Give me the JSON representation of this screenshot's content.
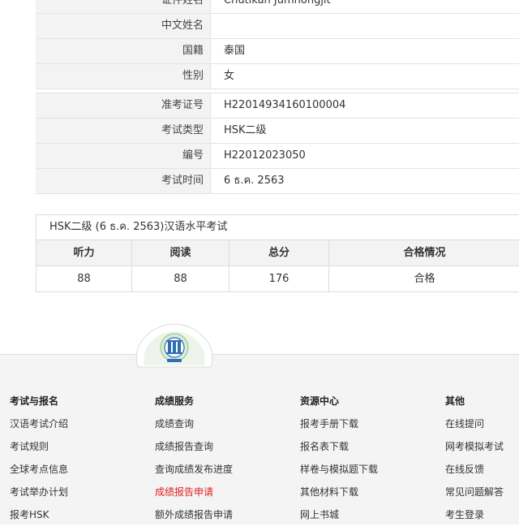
{
  "info": {
    "rows_top": [
      {
        "label": "证件姓名",
        "value": "Chutikan Jumhongjit"
      },
      {
        "label": "中文姓名",
        "value": ""
      },
      {
        "label": "国籍",
        "value": "泰国"
      },
      {
        "label": "性别",
        "value": "女"
      }
    ],
    "rows_bottom": [
      {
        "label": "准考证号",
        "value": "H22014934160100004"
      },
      {
        "label": "考试类型",
        "value": "HSK二级"
      },
      {
        "label": "编号",
        "value": "H22012023050"
      },
      {
        "label": "考试时间",
        "value": "6 ธ.ค. 2563"
      }
    ]
  },
  "result": {
    "title": "HSK二级 (6 ธ.ค. 2563)汉语水平考试",
    "headers": [
      "听力",
      "阅读",
      "总分",
      "合格情况"
    ],
    "values": [
      "88",
      "88",
      "176",
      "合格"
    ]
  },
  "footer": {
    "columns": [
      {
        "title": "考试与报名",
        "items": [
          "汉语考试介绍",
          "考试规则",
          "全球考点信息",
          "考试举办计划",
          "报考HSK"
        ]
      },
      {
        "title": "成绩服务",
        "items": [
          "成绩查询",
          "成绩报告查询",
          "查询成绩发布进度",
          "成绩报告申请",
          "额外成绩报告申请"
        ]
      },
      {
        "title": "资源中心",
        "items": [
          "报考手册下载",
          "报名表下载",
          "样卷与模拟题下载",
          "其他材料下载",
          "网上书城"
        ]
      },
      {
        "title": "其他",
        "items": [
          "在线提问",
          "网考模拟考试",
          "在线反馈",
          "常见问题解答",
          "考生登录"
        ]
      }
    ],
    "highlight_color": "#e02020"
  }
}
